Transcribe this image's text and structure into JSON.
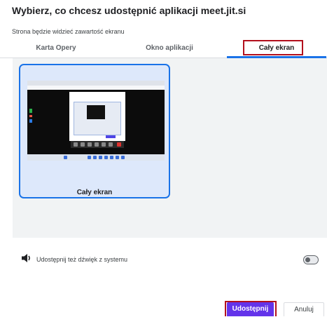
{
  "dialog": {
    "title": "Wybierz, co chcesz udostępnić aplikacji meet.jit.si",
    "subtitle": "Strona będzie widzieć zawartość ekranu"
  },
  "tabs": [
    {
      "label": "Karta Opery",
      "active": false
    },
    {
      "label": "Okno aplikacji",
      "active": false
    },
    {
      "label": "Cały ekran",
      "active": true
    }
  ],
  "sources": [
    {
      "label": "Cały ekran",
      "selected": true
    }
  ],
  "audio": {
    "label": "Udostępnij też dźwięk z systemu",
    "enabled": false,
    "icon": "speaker-icon"
  },
  "buttons": {
    "share": "Udostępnij",
    "cancel": "Anuluj"
  },
  "colors": {
    "accent": "#1a73e8",
    "share_button": "#6333ea",
    "highlight_box": "#b3101d"
  }
}
